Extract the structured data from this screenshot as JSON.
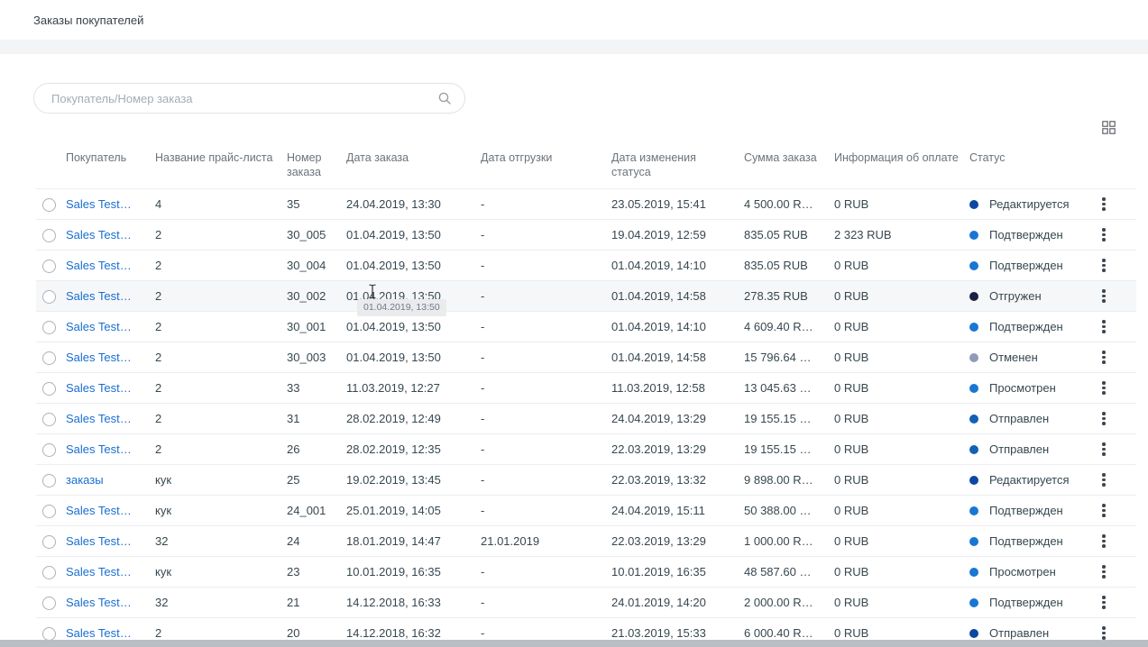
{
  "page": {
    "title": "Заказы покупателей"
  },
  "search": {
    "placeholder": "Покупатель/Номер заказа"
  },
  "icons": {
    "search": "search-icon",
    "columns": "column-settings-icon",
    "row_menu": "kebab-menu-icon"
  },
  "colors": {
    "link": "#1a6ed0",
    "status_editing": "#0d47a1",
    "status_confirmed": "#1976d2",
    "status_shipped": "#1b2145",
    "status_cancelled": "#929ab8",
    "status_viewed": "#1976d2",
    "status_sent": "#1460b4"
  },
  "tooltip": {
    "text": "01.04.2019, 13:50"
  },
  "table": {
    "columns": [
      "Покупатель",
      "Название прайс-листа",
      "Номер заказа",
      "Дата заказа",
      "Дата отгрузки",
      "Дата изменения статуса",
      "Сумма заказа",
      "Информация об оплате",
      "Статус"
    ],
    "rows": [
      {
        "customer": "Sales Test…",
        "price_list": "4",
        "number": "35",
        "order_date": "24.04.2019, 13:30",
        "ship_date": "-",
        "status_change_date": "23.05.2019, 15:41",
        "amount": "4 500.00 R…",
        "payment": "0 RUB",
        "status": "Редактируется",
        "status_color": "#0d47a1",
        "highlighted": false
      },
      {
        "customer": "Sales Test…",
        "price_list": "2",
        "number": "30_005",
        "order_date": "01.04.2019, 13:50",
        "ship_date": "-",
        "status_change_date": "19.04.2019, 12:59",
        "amount": "835.05 RUB",
        "payment": "2 323 RUB",
        "status": "Подтвержден",
        "status_color": "#1976d2",
        "highlighted": false
      },
      {
        "customer": "Sales Test…",
        "price_list": "2",
        "number": "30_004",
        "order_date": "01.04.2019, 13:50",
        "ship_date": "-",
        "status_change_date": "01.04.2019, 14:10",
        "amount": "835.05 RUB",
        "payment": "0 RUB",
        "status": "Подтвержден",
        "status_color": "#1976d2",
        "highlighted": false
      },
      {
        "customer": "Sales Test…",
        "price_list": "2",
        "number": "30_002",
        "order_date": "01.04.2019, 13:50",
        "ship_date": "-",
        "status_change_date": "01.04.2019, 14:58",
        "amount": "278.35 RUB",
        "payment": "0 RUB",
        "status": "Отгружен",
        "status_color": "#1b2145",
        "highlighted": true
      },
      {
        "customer": "Sales Test…",
        "price_list": "2",
        "number": "30_001",
        "order_date": "01.04.2019, 13:50",
        "ship_date": "-",
        "status_change_date": "01.04.2019, 14:10",
        "amount": "4 609.40 R…",
        "payment": "0 RUB",
        "status": "Подтвержден",
        "status_color": "#1976d2",
        "highlighted": false
      },
      {
        "customer": "Sales Test…",
        "price_list": "2",
        "number": "30_003",
        "order_date": "01.04.2019, 13:50",
        "ship_date": "-",
        "status_change_date": "01.04.2019, 14:58",
        "amount": "15 796.64 …",
        "payment": "0 RUB",
        "status": "Отменен",
        "status_color": "#929ab8",
        "highlighted": false
      },
      {
        "customer": "Sales Test…",
        "price_list": "2",
        "number": "33",
        "order_date": "11.03.2019, 12:27",
        "ship_date": "-",
        "status_change_date": "11.03.2019, 12:58",
        "amount": "13 045.63 …",
        "payment": "0 RUB",
        "status": "Просмотрен",
        "status_color": "#1976d2",
        "highlighted": false
      },
      {
        "customer": "Sales Test…",
        "price_list": "2",
        "number": "31",
        "order_date": "28.02.2019, 12:49",
        "ship_date": "-",
        "status_change_date": "24.04.2019, 13:29",
        "amount": "19 155.15 …",
        "payment": "0 RUB",
        "status": "Отправлен",
        "status_color": "#1460b4",
        "highlighted": false
      },
      {
        "customer": "Sales Test…",
        "price_list": "2",
        "number": "26",
        "order_date": "28.02.2019, 12:35",
        "ship_date": "-",
        "status_change_date": "22.03.2019, 13:29",
        "amount": "19 155.15 …",
        "payment": "0 RUB",
        "status": "Отправлен",
        "status_color": "#1460b4",
        "highlighted": false
      },
      {
        "customer": "заказы",
        "price_list": "кук",
        "number": "25",
        "order_date": "19.02.2019, 13:45",
        "ship_date": "-",
        "status_change_date": "22.03.2019, 13:32",
        "amount": "9 898.00 R…",
        "payment": "0 RUB",
        "status": "Редактируется",
        "status_color": "#0d47a1",
        "highlighted": false
      },
      {
        "customer": "Sales Test…",
        "price_list": "кук",
        "number": "24_001",
        "order_date": "25.01.2019, 14:05",
        "ship_date": "-",
        "status_change_date": "24.04.2019, 15:11",
        "amount": "50 388.00 …",
        "payment": "0 RUB",
        "status": "Подтвержден",
        "status_color": "#1976d2",
        "highlighted": false
      },
      {
        "customer": "Sales Test…",
        "price_list": "32",
        "number": "24",
        "order_date": "18.01.2019, 14:47",
        "ship_date": "21.01.2019",
        "status_change_date": "22.03.2019, 13:29",
        "amount": "1 000.00 R…",
        "payment": "0 RUB",
        "status": "Подтвержден",
        "status_color": "#1976d2",
        "highlighted": false
      },
      {
        "customer": "Sales Test…",
        "price_list": "кук",
        "number": "23",
        "order_date": "10.01.2019, 16:35",
        "ship_date": "-",
        "status_change_date": "10.01.2019, 16:35",
        "amount": "48 587.60 …",
        "payment": "0 RUB",
        "status": "Просмотрен",
        "status_color": "#1976d2",
        "highlighted": false
      },
      {
        "customer": "Sales Test…",
        "price_list": "32",
        "number": "21",
        "order_date": "14.12.2018, 16:33",
        "ship_date": "-",
        "status_change_date": "24.01.2019, 14:20",
        "amount": "2 000.00 R…",
        "payment": "0 RUB",
        "status": "Подтвержден",
        "status_color": "#1976d2",
        "highlighted": false
      },
      {
        "customer": "Sales Test…",
        "price_list": "2",
        "number": "20",
        "order_date": "14.12.2018, 16:32",
        "ship_date": "-",
        "status_change_date": "21.03.2019, 15:33",
        "amount": "6 000.40 R…",
        "payment": "0 RUB",
        "status": "Отправлен",
        "status_color": "#0d47a1",
        "highlighted": false
      }
    ]
  }
}
